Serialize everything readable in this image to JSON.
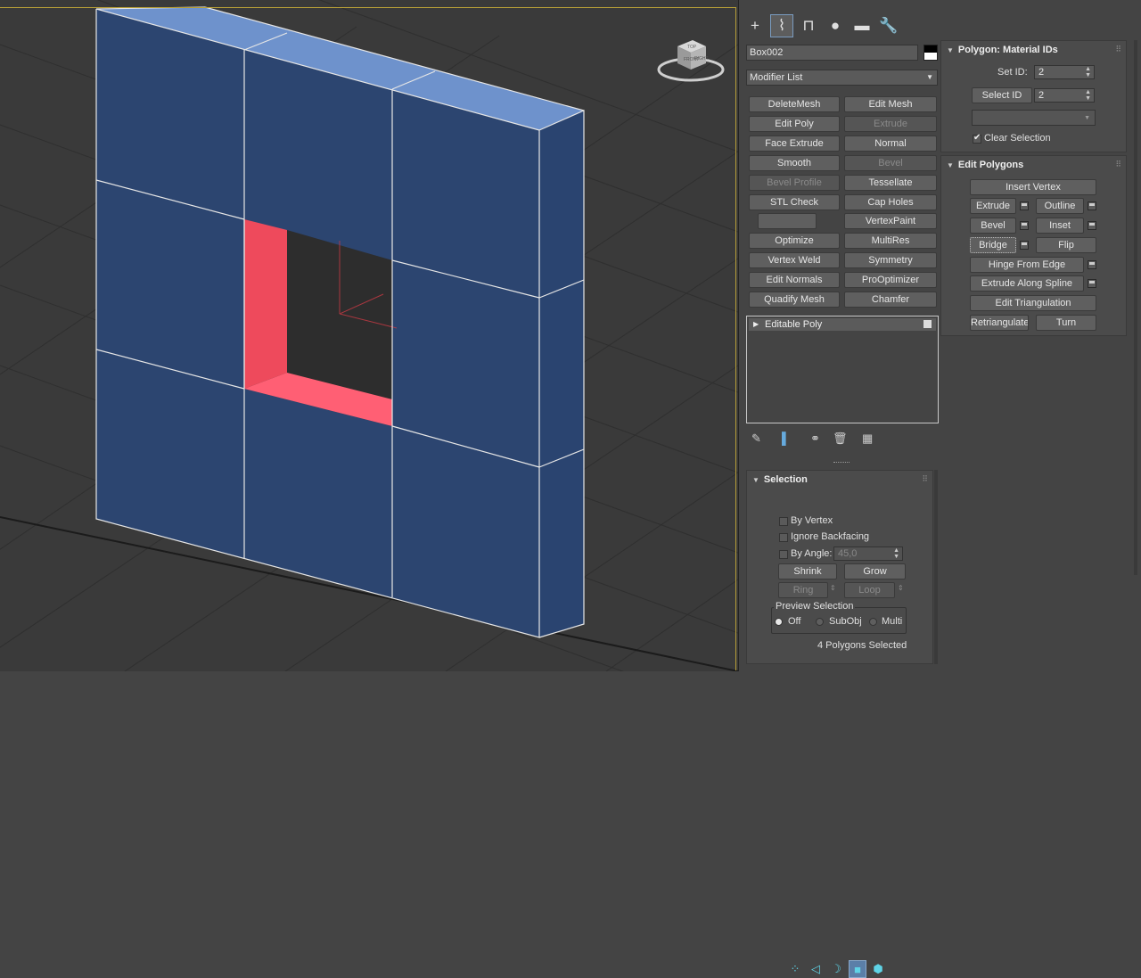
{
  "command_tabs": [
    {
      "name": "create-tab",
      "glyph": "+"
    },
    {
      "name": "modify-tab",
      "glyph": "⌇"
    },
    {
      "name": "hierarchy-tab",
      "glyph": "⊓"
    },
    {
      "name": "motion-tab",
      "glyph": "●"
    },
    {
      "name": "display-tab",
      "glyph": "▬"
    },
    {
      "name": "utilities-tab",
      "glyph": "🔧"
    }
  ],
  "object_name": "Box002",
  "object_color": "#ffffff",
  "modifier_list_label": "Modifier List",
  "modifier_buttons": [
    {
      "label": "DeleteMesh",
      "enabled": true
    },
    {
      "label": "Edit Mesh",
      "enabled": true
    },
    {
      "label": "Edit Poly",
      "enabled": true
    },
    {
      "label": "Extrude",
      "enabled": false
    },
    {
      "label": "Face Extrude",
      "enabled": true
    },
    {
      "label": "Normal",
      "enabled": true
    },
    {
      "label": "Smooth",
      "enabled": true
    },
    {
      "label": "Bevel",
      "enabled": false
    },
    {
      "label": "Bevel Profile",
      "enabled": false
    },
    {
      "label": "Tessellate",
      "enabled": true
    },
    {
      "label": "STL Check",
      "enabled": true
    },
    {
      "label": "Cap Holes",
      "enabled": true
    },
    {
      "label": "",
      "enabled": true
    },
    {
      "label": "VertexPaint",
      "enabled": true
    },
    {
      "label": "Optimize",
      "enabled": true
    },
    {
      "label": "MultiRes",
      "enabled": true
    },
    {
      "label": "Vertex Weld",
      "enabled": true
    },
    {
      "label": "Symmetry",
      "enabled": true
    },
    {
      "label": "Edit Normals",
      "enabled": true
    },
    {
      "label": "ProOptimizer",
      "enabled": true
    },
    {
      "label": "Quadify Mesh",
      "enabled": true
    },
    {
      "label": "Chamfer",
      "enabled": true
    }
  ],
  "modifier_stack": [
    {
      "label": "Editable Poly"
    }
  ],
  "material_ids": {
    "title": "Polygon: Material IDs",
    "set_id_label": "Set ID:",
    "set_id_value": "2",
    "select_id_label": "Select ID",
    "select_id_value": "2",
    "clear_selection_label": "Clear Selection",
    "clear_selection_checked": true
  },
  "edit_polygons": {
    "title": "Edit Polygons",
    "insert_vertex": "Insert Vertex",
    "extrude": "Extrude",
    "outline": "Outline",
    "bevel": "Bevel",
    "inset": "Inset",
    "bridge": "Bridge",
    "flip": "Flip",
    "hinge_from_edge": "Hinge From Edge",
    "extrude_along_spline": "Extrude Along Spline",
    "edit_triangulation": "Edit Triangulation",
    "retriangulate": "Retriangulate",
    "turn": "Turn"
  },
  "selection": {
    "title": "Selection",
    "by_vertex": "By Vertex",
    "ignore_backfacing": "Ignore Backfacing",
    "by_angle": "By Angle:",
    "by_angle_value": "45,0",
    "shrink": "Shrink",
    "grow": "Grow",
    "ring": "Ring",
    "loop": "Loop",
    "preview_selection": "Preview Selection",
    "preview_off": "Off",
    "preview_subobj": "SubObj",
    "preview_multi": "Multi",
    "status": "4 Polygons Selected"
  },
  "viewcube_faces": {
    "top": "TOP",
    "front": "FRONT",
    "right": "RIGHT"
  },
  "colors": {
    "mesh_face": "#2c4570",
    "mesh_top": "#6e92cc",
    "selected_face": "#ee4a5c",
    "selection_accent": "#5b7fa8"
  }
}
